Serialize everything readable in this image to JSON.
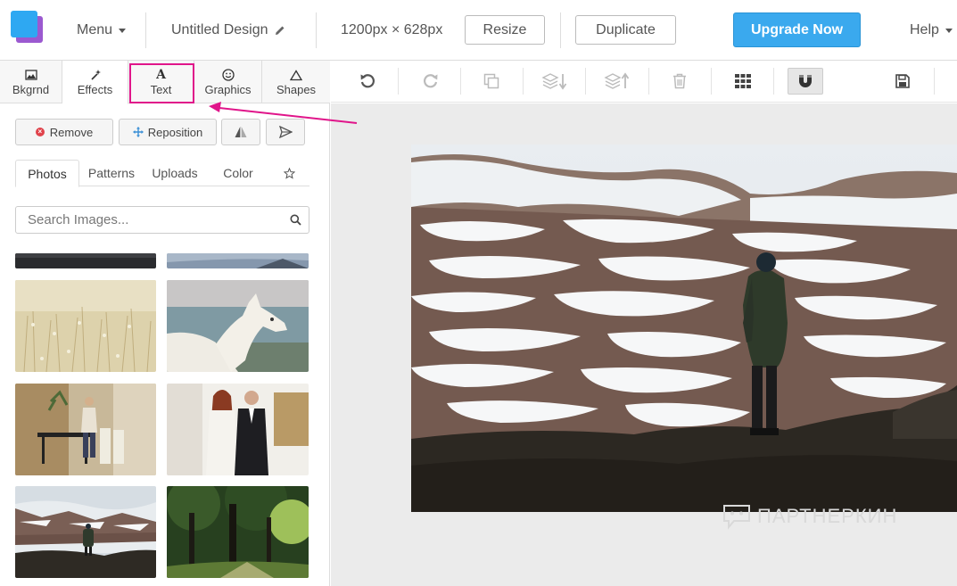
{
  "app": {
    "menu_label": "Menu",
    "design_title": "Untitled Design",
    "dimensions": "1200px × 628px",
    "resize_label": "Resize",
    "duplicate_label": "Duplicate",
    "upgrade_label": "Upgrade Now",
    "help_label": "Help"
  },
  "colors": {
    "accent": "#3aa9ee",
    "highlight": "#e0158a",
    "logo_front": "#2ea8f2",
    "logo_back": "#9b59d0"
  },
  "category_tabs": [
    {
      "label": "Bkgrnd",
      "icon": "image-icon"
    },
    {
      "label": "Effects",
      "icon": "magic-wand-icon"
    },
    {
      "label": "Text",
      "icon": "text-a-icon"
    },
    {
      "label": "Graphics",
      "icon": "smiley-icon"
    },
    {
      "label": "Shapes",
      "icon": "triangle-icon"
    }
  ],
  "actions": {
    "remove_label": "Remove",
    "reposition_label": "Reposition",
    "flip_icon": "flip-icon",
    "send_icon": "send-icon"
  },
  "sub_tabs": [
    {
      "label": "Photos",
      "active": true
    },
    {
      "label": "Patterns"
    },
    {
      "label": "Uploads"
    },
    {
      "label": "Color"
    },
    {
      "icon": "star-icon"
    }
  ],
  "search": {
    "placeholder": "Search Images..."
  },
  "thumbnails": [
    {
      "name": "dark-strip"
    },
    {
      "name": "blue-strip"
    },
    {
      "name": "dry-grass-field"
    },
    {
      "name": "white-llama"
    },
    {
      "name": "woman-in-kitchen"
    },
    {
      "name": "couple-formal"
    },
    {
      "name": "hiker-snowy-mountains"
    },
    {
      "name": "forest-trees"
    }
  ],
  "toolbar": {
    "tools": [
      "undo-icon",
      "redo-icon",
      "copy-icon",
      "layer-down-icon",
      "layer-up-icon",
      "trash-icon",
      "grid-icon",
      "magnet-icon",
      "save-icon"
    ]
  },
  "canvas": {
    "image": "hiker-snowy-mountains",
    "watermark": "ПАРТНЕРКИН"
  }
}
